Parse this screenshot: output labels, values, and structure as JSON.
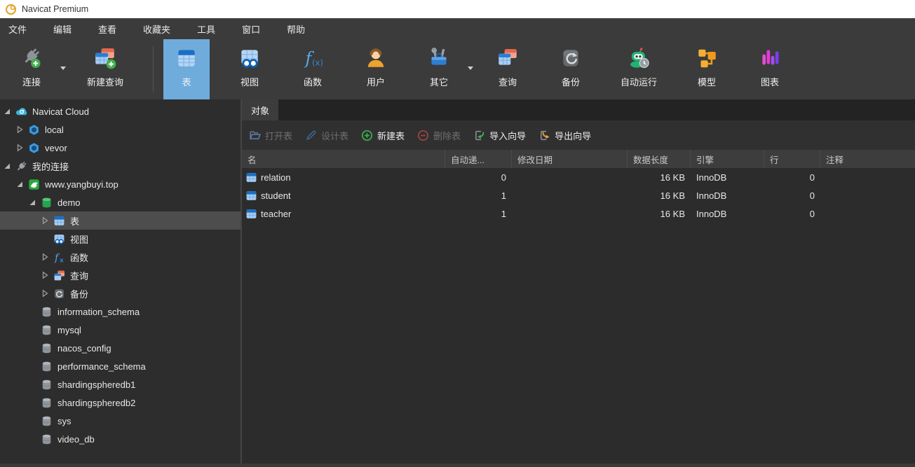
{
  "window": {
    "title": "Navicat Premium"
  },
  "menu": {
    "items": [
      "文件",
      "编辑",
      "查看",
      "收藏夹",
      "工具",
      "窗口",
      "帮助"
    ]
  },
  "toolbar": {
    "buttons": [
      {
        "id": "connect",
        "label": "连接",
        "icon": "connection-new-icon",
        "dropdown": true,
        "active": false,
        "separator_before": false
      },
      {
        "id": "new-query",
        "label": "新建查询",
        "icon": "new-query-icon",
        "dropdown": false,
        "active": false,
        "separator_before": false
      },
      {
        "id": "tables",
        "label": "表",
        "icon": "table-icon",
        "dropdown": false,
        "active": true,
        "separator_before": true
      },
      {
        "id": "views",
        "label": "视图",
        "icon": "view-icon",
        "dropdown": false,
        "active": false,
        "separator_before": false
      },
      {
        "id": "functions",
        "label": "函数",
        "icon": "function-icon",
        "dropdown": false,
        "active": false,
        "separator_before": false
      },
      {
        "id": "users",
        "label": "用户",
        "icon": "user-icon",
        "dropdown": false,
        "active": false,
        "separator_before": false
      },
      {
        "id": "others",
        "label": "其它",
        "icon": "others-icon",
        "dropdown": true,
        "active": false,
        "separator_before": false
      },
      {
        "id": "query",
        "label": "查询",
        "icon": "query-icon",
        "dropdown": false,
        "active": false,
        "separator_before": false
      },
      {
        "id": "backup",
        "label": "备份",
        "icon": "backup-icon",
        "dropdown": false,
        "active": false,
        "separator_before": false
      },
      {
        "id": "automation",
        "label": "自动运行",
        "icon": "automation-icon",
        "dropdown": false,
        "active": false,
        "separator_before": false
      },
      {
        "id": "model",
        "label": "模型",
        "icon": "model-icon",
        "dropdown": false,
        "active": false,
        "separator_before": false
      },
      {
        "id": "charts",
        "label": "图表",
        "icon": "chart-icon",
        "dropdown": false,
        "active": false,
        "separator_before": false
      }
    ]
  },
  "sidebar": {
    "items": [
      {
        "id": "navicat-cloud",
        "label": "Navicat Cloud",
        "level": 0,
        "state": "expanded",
        "icon": "navicat-cloud-icon",
        "selected": false
      },
      {
        "id": "local",
        "label": "local",
        "level": 1,
        "state": "collapsed",
        "icon": "connection-hex-icon",
        "selected": false
      },
      {
        "id": "vevor",
        "label": "vevor",
        "level": 1,
        "state": "collapsed",
        "icon": "connection-hex-icon",
        "selected": false
      },
      {
        "id": "my-connections",
        "label": "我的连接",
        "level": 0,
        "state": "expanded",
        "icon": "plug-icon",
        "selected": false
      },
      {
        "id": "www-yangbuyi-top",
        "label": "www.yangbuyi.top",
        "level": 1,
        "state": "expanded",
        "icon": "mysql-connection-icon",
        "selected": false
      },
      {
        "id": "demo",
        "label": "demo",
        "level": 2,
        "state": "expanded",
        "icon": "database-open-icon",
        "selected": false
      },
      {
        "id": "tables",
        "label": "表",
        "level": 3,
        "state": "collapsed",
        "icon": "tables-icon",
        "selected": true
      },
      {
        "id": "views",
        "label": "视图",
        "level": 3,
        "state": "none",
        "icon": "views-icon",
        "selected": false
      },
      {
        "id": "functions",
        "label": "函数",
        "level": 3,
        "state": "collapsed",
        "icon": "functions-icon",
        "selected": false
      },
      {
        "id": "queries",
        "label": "查询",
        "level": 3,
        "state": "collapsed",
        "icon": "queries-icon",
        "selected": false
      },
      {
        "id": "backups",
        "label": "备份",
        "level": 3,
        "state": "collapsed",
        "icon": "backups-icon",
        "selected": false
      },
      {
        "id": "information-schema",
        "label": "information_schema",
        "level": 2,
        "state": "none",
        "icon": "database-gray-icon",
        "selected": false
      },
      {
        "id": "mysql",
        "label": "mysql",
        "level": 2,
        "state": "none",
        "icon": "database-gray-icon",
        "selected": false
      },
      {
        "id": "nacos-config",
        "label": "nacos_config",
        "level": 2,
        "state": "none",
        "icon": "database-gray-icon",
        "selected": false
      },
      {
        "id": "performance-schema",
        "label": "performance_schema",
        "level": 2,
        "state": "none",
        "icon": "database-gray-icon",
        "selected": false
      },
      {
        "id": "shardingspheredb1",
        "label": "shardingspheredb1",
        "level": 2,
        "state": "none",
        "icon": "database-gray-icon",
        "selected": false
      },
      {
        "id": "shardingspheredb2",
        "label": "shardingspheredb2",
        "level": 2,
        "state": "none",
        "icon": "database-gray-icon",
        "selected": false
      },
      {
        "id": "sys",
        "label": "sys",
        "level": 2,
        "state": "none",
        "icon": "database-gray-icon",
        "selected": false
      },
      {
        "id": "video-db",
        "label": "video_db",
        "level": 2,
        "state": "none",
        "icon": "database-gray-icon",
        "selected": false
      }
    ]
  },
  "main": {
    "tabs": [
      {
        "label": "对象",
        "active": true
      }
    ],
    "object_toolbar": [
      {
        "id": "open-table",
        "label": "打开表",
        "icon": "open-table-icon",
        "enabled": false
      },
      {
        "id": "design-table",
        "label": "设计表",
        "icon": "design-table-icon",
        "enabled": false
      },
      {
        "id": "new-table",
        "label": "新建表",
        "icon": "new-table-icon",
        "enabled": true
      },
      {
        "id": "delete-table",
        "label": "删除表",
        "icon": "delete-table-icon",
        "enabled": false
      },
      {
        "id": "import-wizard",
        "label": "导入向导",
        "icon": "import-wizard-icon",
        "enabled": true
      },
      {
        "id": "export-wizard",
        "label": "导出向导",
        "icon": "export-wizard-icon",
        "enabled": true
      }
    ],
    "table": {
      "columns": [
        "名",
        "自动递...",
        "修改日期",
        "数据长度",
        "引擎",
        "行",
        "注释"
      ],
      "rows": [
        {
          "name": "relation",
          "auto_increment": "0",
          "modify_date": "",
          "data_length": "16 KB",
          "engine": "InnoDB",
          "rows": "0",
          "comment": ""
        },
        {
          "name": "student",
          "auto_increment": "1",
          "modify_date": "",
          "data_length": "16 KB",
          "engine": "InnoDB",
          "rows": "0",
          "comment": ""
        },
        {
          "name": "teacher",
          "auto_increment": "1",
          "modify_date": "",
          "data_length": "16 KB",
          "engine": "InnoDB",
          "rows": "0",
          "comment": ""
        }
      ]
    }
  },
  "colors": {
    "titlebar_bg": "#ffffff",
    "chrome_bg": "#3b3b3b",
    "content_bg": "#2d2d2d",
    "active_button_blue": "#6facdc",
    "selection_gray": "#4d4d4d",
    "enabled_green": "#3fae4a",
    "disabled_text": "#6f6f6f"
  }
}
